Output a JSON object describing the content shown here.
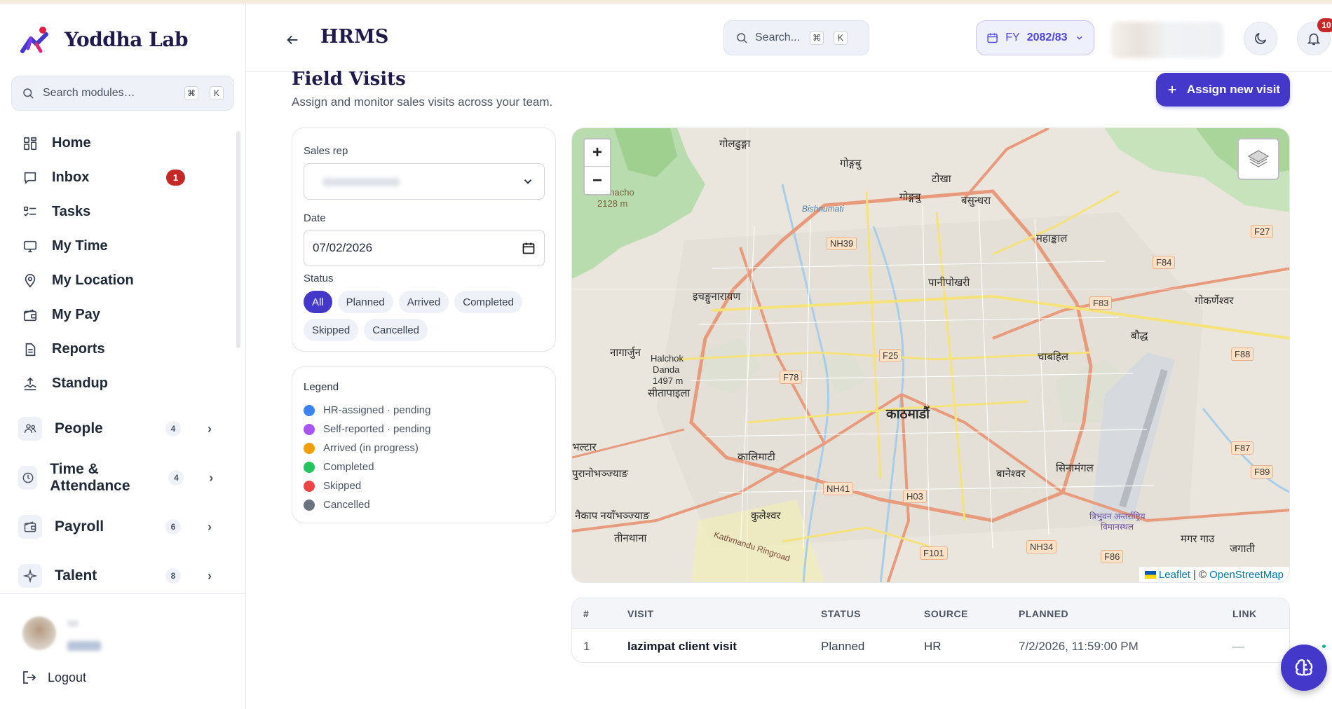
{
  "sidebar": {
    "brand": "Yoddha Lab",
    "search_placeholder": "Search modules…",
    "search_kbd": [
      "⌘",
      "K"
    ],
    "nav": [
      {
        "label": "Home",
        "icon": "grid-icon"
      },
      {
        "label": "Inbox",
        "icon": "inbox-icon",
        "badge": "1"
      },
      {
        "label": "Tasks",
        "icon": "tasks-icon"
      },
      {
        "label": "My Time",
        "icon": "monitor-icon"
      },
      {
        "label": "My Location",
        "icon": "location-pin-icon"
      },
      {
        "label": "My Pay",
        "icon": "wallet-icon"
      },
      {
        "label": "Reports",
        "icon": "document-icon"
      },
      {
        "label": "Standup",
        "icon": "standup-icon"
      }
    ],
    "groups": [
      {
        "label": "People",
        "count": "4",
        "icon": "people-icon"
      },
      {
        "label": "Time & Attendance",
        "count": "4",
        "icon": "clock-icon"
      },
      {
        "label": "Payroll",
        "count": "6",
        "icon": "wallet-icon"
      },
      {
        "label": "Talent",
        "count": "8",
        "icon": "sparkle-icon"
      }
    ],
    "logout_label": "Logout"
  },
  "header": {
    "title": "HRMS",
    "search_placeholder": "Search...",
    "search_kbd": [
      "⌘",
      "K"
    ],
    "fy_prefix": "FY",
    "fy_value": "2082/83",
    "notification_count": "10"
  },
  "page": {
    "title": "Field Visits",
    "subtitle": "Assign and monitor sales visits across your team.",
    "assign_button": "Assign new visit"
  },
  "filters": {
    "sales_rep_label": "Sales rep",
    "date_label": "Date",
    "date_value": "07/02/2026",
    "status_label": "Status",
    "statuses": [
      "All",
      "Planned",
      "Arrived",
      "Completed",
      "Skipped",
      "Cancelled"
    ],
    "active_status": "All"
  },
  "legend": {
    "title": "Legend",
    "items": [
      {
        "label": "HR-assigned · pending",
        "color": "#3b82f6"
      },
      {
        "label": "Self-reported · pending",
        "color": "#a855f7"
      },
      {
        "label": "Arrived (in progress)",
        "color": "#f59e0b"
      },
      {
        "label": "Completed",
        "color": "#22c55e"
      },
      {
        "label": "Skipped",
        "color": "#ef4444"
      },
      {
        "label": "Cancelled",
        "color": "#6b7280"
      }
    ]
  },
  "map": {
    "zoom_in": "+",
    "zoom_out": "−",
    "attribution_leaflet": "Leaflet",
    "attribution_sep": "| ©",
    "attribution_osm": "OpenStreetMap",
    "labels": {
      "l1": "गोलढुङ्गा",
      "l2": "गोङ्गबु",
      "l3": "टोखा",
      "l4": "गोङ्गबु",
      "l5": "बसुन्धरा",
      "l6": "महाङ्काल",
      "l7": "पानीपोखरी",
      "l8": "इचङ्गुनारायण",
      "l9": "गोकर्णेश्वर",
      "l10": "बौद्ध",
      "l11": "चाबहिल",
      "l12": "नागार्जुन",
      "l13": "Halchok",
      "l14": "Danda",
      "l15": "1497 m",
      "l16": "सीतापाइला",
      "l17": "काठमाडौं",
      "l18": "कालिमाटी",
      "l19": "बानेश्वर",
      "l20": "सिनामंगल",
      "l21": "भल्टार",
      "l22": "पुरानोभञ्ज्याङ",
      "l23": "नैकाप नयाँभञ्ज्याङ",
      "l24": "तीनथाना",
      "l25": "कुलेश्वर",
      "l26": "मगर गाउ",
      "l27": "जगाती",
      "l28": "Jamacho",
      "l29": "2128 m",
      "l30": "त्रिभुवन अन्तर्राष्ट्रिय",
      "l31": "विमानस्थल",
      "l32": "Bishnumati",
      "l33": "Kathmandu Ringroad"
    },
    "shields": {
      "s1": "NH39",
      "s2": "F27",
      "s3": "F84",
      "s4": "F83",
      "s5": "F25",
      "s6": "F88",
      "s7": "F78",
      "s8": "F87",
      "s9": "F89",
      "s10": "NH41",
      "s11": "H03",
      "s12": "F101",
      "s13": "NH34",
      "s14": "F86"
    }
  },
  "visits_table": {
    "columns": [
      "#",
      "VISIT",
      "STATUS",
      "SOURCE",
      "PLANNED",
      "LINK"
    ],
    "rows": [
      {
        "num": "1",
        "visit": "lazimpat client visit",
        "status": "Planned",
        "source": "HR",
        "planned": "7/2/2026, 11:59:00 PM",
        "link": "—"
      }
    ]
  }
}
